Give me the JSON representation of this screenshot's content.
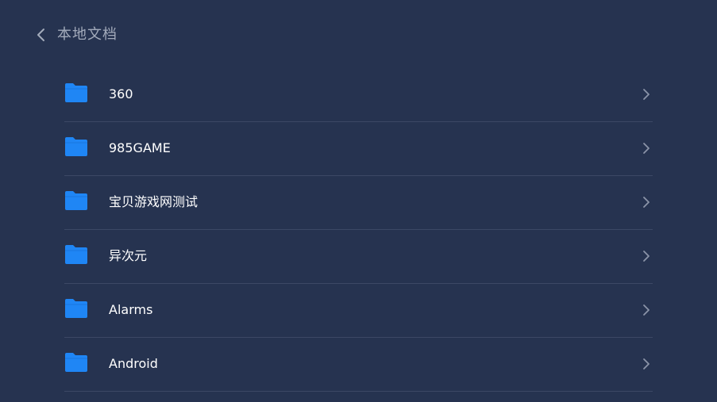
{
  "header": {
    "back_icon": "chevron-left-icon",
    "title": "本地文档"
  },
  "colors": {
    "background": "#263350",
    "folder": "#1f86f5",
    "text": "#ffffff",
    "title": "#a3abbb",
    "divider": "#3c4865",
    "chevron": "#8b94a8"
  },
  "files": [
    {
      "name": "360",
      "icon": "folder-icon"
    },
    {
      "name": "985GAME",
      "icon": "folder-icon"
    },
    {
      "name": "宝贝游戏网测试",
      "icon": "folder-icon"
    },
    {
      "name": "异次元",
      "icon": "folder-icon"
    },
    {
      "name": "Alarms",
      "icon": "folder-icon"
    },
    {
      "name": "Android",
      "icon": "folder-icon"
    }
  ]
}
